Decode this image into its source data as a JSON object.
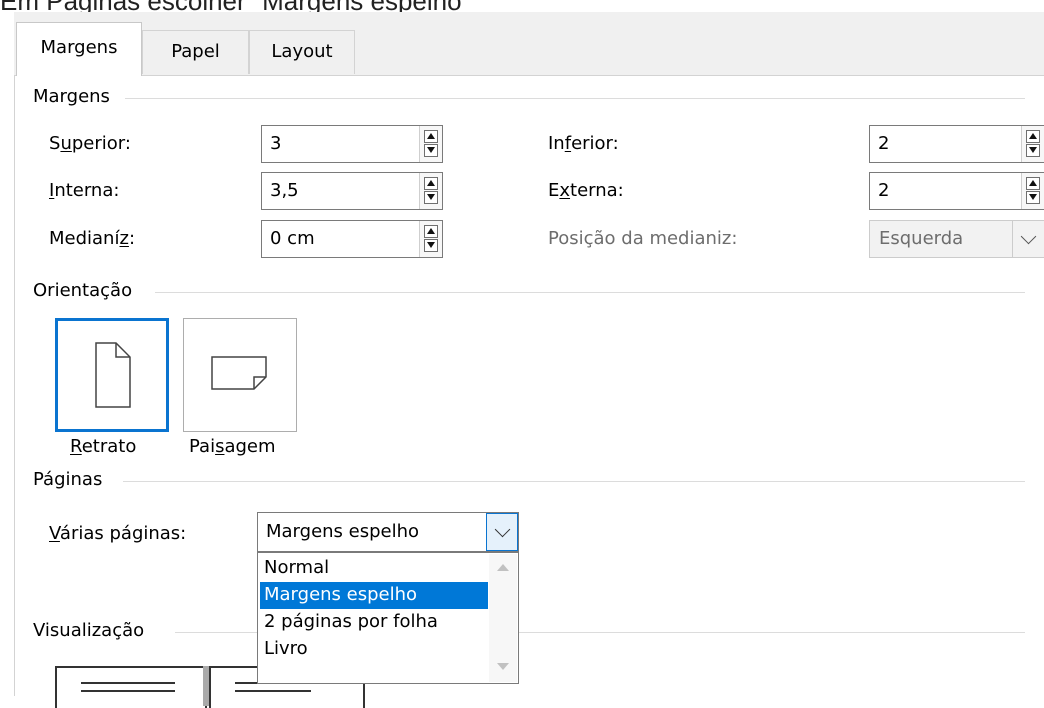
{
  "caption": "Em Páginas escolher \"Margens espelho\"",
  "tabs": [
    "Margens",
    "Papel",
    "Layout"
  ],
  "margins": {
    "group_title": "Margens",
    "superior": {
      "label_pre": "S",
      "label_u": "u",
      "label_post": "perior:",
      "value": "3"
    },
    "inferior": {
      "label_pre": "In",
      "label_u": "f",
      "label_post": "erior:",
      "value": "2"
    },
    "interna": {
      "label_pre": "",
      "label_u": "I",
      "label_post": "nterna:",
      "value": "3,5"
    },
    "externa": {
      "label_pre": "E",
      "label_u": "x",
      "label_post": "terna:",
      "value": "2"
    },
    "medianiz": {
      "label_pre": "Medianí",
      "label_u": "z",
      "label_post": ":",
      "value": "0 cm"
    },
    "posicao": {
      "label": "Posição da medianiz:",
      "value": "Esquerda"
    }
  },
  "orientation": {
    "group_title": "Orientação",
    "retrato": {
      "u": "R",
      "rest": "etrato"
    },
    "paisagem": {
      "pre": "Pai",
      "u": "s",
      "rest": "agem"
    }
  },
  "pages": {
    "group_title": "Páginas",
    "label_u": "V",
    "label_rest": "árias páginas:",
    "selected": "Margens espelho",
    "options": [
      "Normal",
      "Margens espelho",
      "2 páginas por folha",
      "Livro"
    ],
    "selected_index": 1
  },
  "preview": {
    "group_title": "Visualização"
  }
}
